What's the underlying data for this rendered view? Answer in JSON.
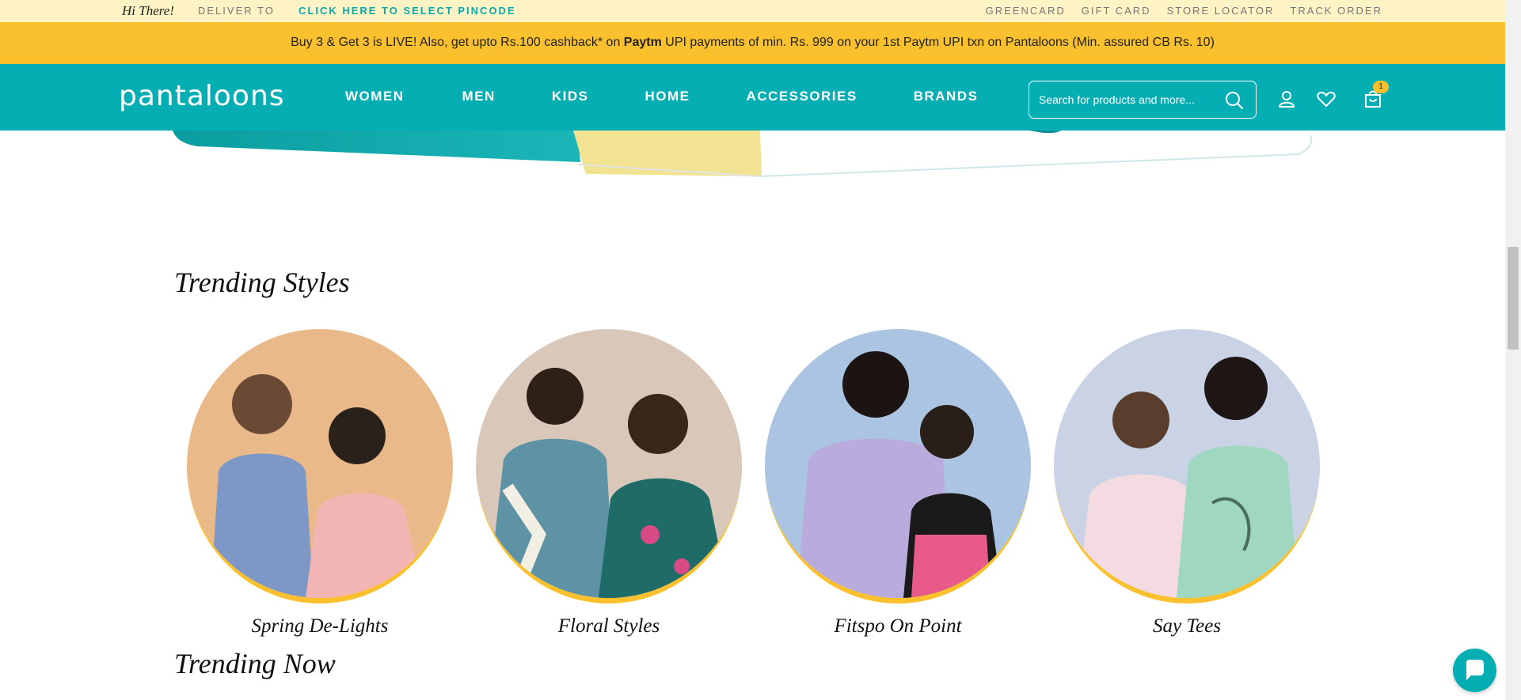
{
  "utility_bar": {
    "greeting": "Hi There!",
    "deliver_to": "DELIVER TO",
    "pincode_link": "CLICK HERE TO SELECT PINCODE",
    "links": [
      "GREENCARD",
      "GIFT CARD",
      "STORE LOCATOR",
      "TRACK ORDER"
    ]
  },
  "promo": {
    "text_1": "Buy 3 & Get 3 is LIVE! Also, get upto Rs.100 cashback* on ",
    "brand": "Paytm",
    "text_2": " UPI payments of min. Rs. 999 on your 1st Paytm UPI txn on Pantaloons (Min. assured CB Rs. 10)"
  },
  "nav": {
    "logo": "pantaloons",
    "items": [
      "WOMEN",
      "MEN",
      "KIDS",
      "HOME",
      "ACCESSORIES",
      "BRANDS"
    ],
    "search_placeholder": "Search for products and more...",
    "cart_count": "1"
  },
  "trending_styles": {
    "title": "Trending Styles",
    "items": [
      {
        "label": "Spring De-Lights",
        "bg": "#e9b98a"
      },
      {
        "label": "Floral Styles",
        "bg": "#d9c8b9"
      },
      {
        "label": "Fitspo On Point",
        "bg": "#aac4e2"
      },
      {
        "label": "Say Tees",
        "bg": "#c9d3e5"
      }
    ]
  },
  "trending_now": {
    "title": "Trending Now"
  },
  "colors": {
    "teal": "#05aeb3",
    "yellow": "#fbc02d",
    "cream": "#fdf3c4"
  }
}
